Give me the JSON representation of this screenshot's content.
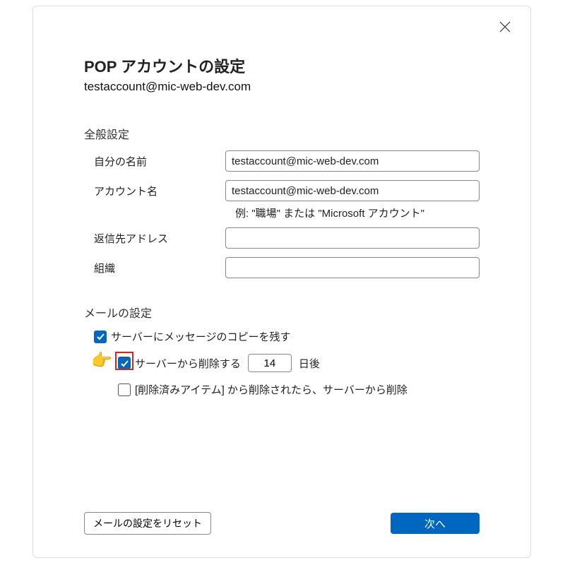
{
  "dialog": {
    "title": "POP アカウントの設定",
    "email": "testaccount@mic-web-dev.com",
    "close_tooltip": "閉じる"
  },
  "general": {
    "heading": "全般設定",
    "labels": {
      "name": "自分の名前",
      "account": "アカウント名",
      "account_hint": "例: \"職場\" または \"Microsoft アカウント\"",
      "reply_to": "返信先アドレス",
      "org": "組織"
    },
    "values": {
      "name": "testaccount@mic-web-dev.com",
      "account": "testaccount@mic-web-dev.com",
      "reply_to": "",
      "org": ""
    }
  },
  "mail": {
    "heading": "メールの設定",
    "leave_copy": {
      "label": "サーバーにメッセージのコピーを残す",
      "checked": true
    },
    "delete_after": {
      "label_before": "サーバーから削除する",
      "label_after": "日後",
      "days": "14",
      "checked": true,
      "highlighted": true
    },
    "delete_when_deleted": {
      "label": "[削除済みアイテム] から削除されたら、サーバーから削除",
      "checked": false
    }
  },
  "buttons": {
    "reset": "メールの設定をリセット",
    "next": "次へ"
  },
  "colors": {
    "primary": "#0067c0",
    "highlight": "#d22"
  }
}
